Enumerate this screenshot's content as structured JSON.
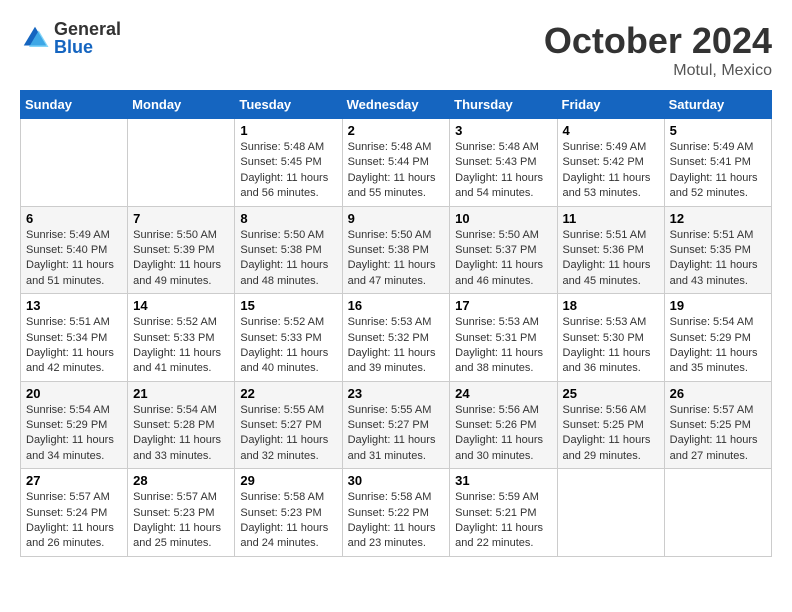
{
  "header": {
    "logo_general": "General",
    "logo_blue": "Blue",
    "month_title": "October 2024",
    "location": "Motul, Mexico"
  },
  "weekdays": [
    "Sunday",
    "Monday",
    "Tuesday",
    "Wednesday",
    "Thursday",
    "Friday",
    "Saturday"
  ],
  "weeks": [
    [
      {
        "day": "",
        "info": ""
      },
      {
        "day": "",
        "info": ""
      },
      {
        "day": "1",
        "info": "Sunrise: 5:48 AM\nSunset: 5:45 PM\nDaylight: 11 hours and 56 minutes."
      },
      {
        "day": "2",
        "info": "Sunrise: 5:48 AM\nSunset: 5:44 PM\nDaylight: 11 hours and 55 minutes."
      },
      {
        "day": "3",
        "info": "Sunrise: 5:48 AM\nSunset: 5:43 PM\nDaylight: 11 hours and 54 minutes."
      },
      {
        "day": "4",
        "info": "Sunrise: 5:49 AM\nSunset: 5:42 PM\nDaylight: 11 hours and 53 minutes."
      },
      {
        "day": "5",
        "info": "Sunrise: 5:49 AM\nSunset: 5:41 PM\nDaylight: 11 hours and 52 minutes."
      }
    ],
    [
      {
        "day": "6",
        "info": "Sunrise: 5:49 AM\nSunset: 5:40 PM\nDaylight: 11 hours and 51 minutes."
      },
      {
        "day": "7",
        "info": "Sunrise: 5:50 AM\nSunset: 5:39 PM\nDaylight: 11 hours and 49 minutes."
      },
      {
        "day": "8",
        "info": "Sunrise: 5:50 AM\nSunset: 5:38 PM\nDaylight: 11 hours and 48 minutes."
      },
      {
        "day": "9",
        "info": "Sunrise: 5:50 AM\nSunset: 5:38 PM\nDaylight: 11 hours and 47 minutes."
      },
      {
        "day": "10",
        "info": "Sunrise: 5:50 AM\nSunset: 5:37 PM\nDaylight: 11 hours and 46 minutes."
      },
      {
        "day": "11",
        "info": "Sunrise: 5:51 AM\nSunset: 5:36 PM\nDaylight: 11 hours and 45 minutes."
      },
      {
        "day": "12",
        "info": "Sunrise: 5:51 AM\nSunset: 5:35 PM\nDaylight: 11 hours and 43 minutes."
      }
    ],
    [
      {
        "day": "13",
        "info": "Sunrise: 5:51 AM\nSunset: 5:34 PM\nDaylight: 11 hours and 42 minutes."
      },
      {
        "day": "14",
        "info": "Sunrise: 5:52 AM\nSunset: 5:33 PM\nDaylight: 11 hours and 41 minutes."
      },
      {
        "day": "15",
        "info": "Sunrise: 5:52 AM\nSunset: 5:33 PM\nDaylight: 11 hours and 40 minutes."
      },
      {
        "day": "16",
        "info": "Sunrise: 5:53 AM\nSunset: 5:32 PM\nDaylight: 11 hours and 39 minutes."
      },
      {
        "day": "17",
        "info": "Sunrise: 5:53 AM\nSunset: 5:31 PM\nDaylight: 11 hours and 38 minutes."
      },
      {
        "day": "18",
        "info": "Sunrise: 5:53 AM\nSunset: 5:30 PM\nDaylight: 11 hours and 36 minutes."
      },
      {
        "day": "19",
        "info": "Sunrise: 5:54 AM\nSunset: 5:29 PM\nDaylight: 11 hours and 35 minutes."
      }
    ],
    [
      {
        "day": "20",
        "info": "Sunrise: 5:54 AM\nSunset: 5:29 PM\nDaylight: 11 hours and 34 minutes."
      },
      {
        "day": "21",
        "info": "Sunrise: 5:54 AM\nSunset: 5:28 PM\nDaylight: 11 hours and 33 minutes."
      },
      {
        "day": "22",
        "info": "Sunrise: 5:55 AM\nSunset: 5:27 PM\nDaylight: 11 hours and 32 minutes."
      },
      {
        "day": "23",
        "info": "Sunrise: 5:55 AM\nSunset: 5:27 PM\nDaylight: 11 hours and 31 minutes."
      },
      {
        "day": "24",
        "info": "Sunrise: 5:56 AM\nSunset: 5:26 PM\nDaylight: 11 hours and 30 minutes."
      },
      {
        "day": "25",
        "info": "Sunrise: 5:56 AM\nSunset: 5:25 PM\nDaylight: 11 hours and 29 minutes."
      },
      {
        "day": "26",
        "info": "Sunrise: 5:57 AM\nSunset: 5:25 PM\nDaylight: 11 hours and 27 minutes."
      }
    ],
    [
      {
        "day": "27",
        "info": "Sunrise: 5:57 AM\nSunset: 5:24 PM\nDaylight: 11 hours and 26 minutes."
      },
      {
        "day": "28",
        "info": "Sunrise: 5:57 AM\nSunset: 5:23 PM\nDaylight: 11 hours and 25 minutes."
      },
      {
        "day": "29",
        "info": "Sunrise: 5:58 AM\nSunset: 5:23 PM\nDaylight: 11 hours and 24 minutes."
      },
      {
        "day": "30",
        "info": "Sunrise: 5:58 AM\nSunset: 5:22 PM\nDaylight: 11 hours and 23 minutes."
      },
      {
        "day": "31",
        "info": "Sunrise: 5:59 AM\nSunset: 5:21 PM\nDaylight: 11 hours and 22 minutes."
      },
      {
        "day": "",
        "info": ""
      },
      {
        "day": "",
        "info": ""
      }
    ]
  ]
}
